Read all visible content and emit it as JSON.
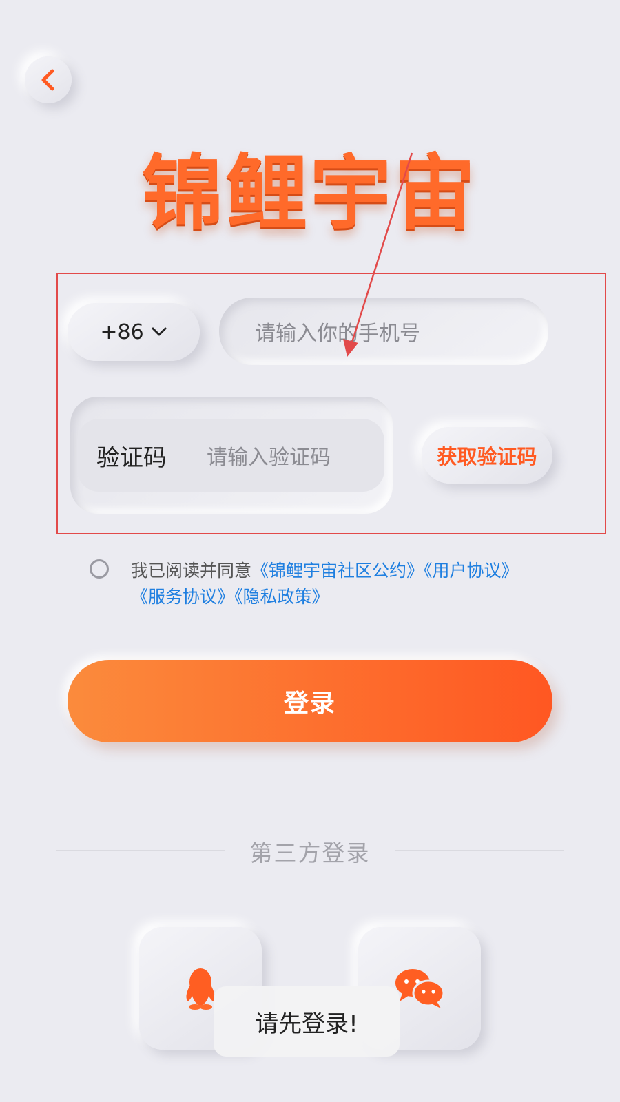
{
  "app": {
    "logo_text": "锦鲤宇宙"
  },
  "phone": {
    "country_code": "+86",
    "placeholder": "请输入你的手机号"
  },
  "verify": {
    "label": "验证码",
    "placeholder": "请输入验证码",
    "get_code": "获取验证码"
  },
  "agreement": {
    "prefix": "我已阅读并同意",
    "links": [
      "《锦鲤宇宙社区公约》",
      "《用户协议》",
      "《服务协议》",
      "《隐私政策》"
    ]
  },
  "login": {
    "label": "登录"
  },
  "third_party": {
    "title": "第三方登录",
    "options": [
      "qq-icon",
      "wechat-icon"
    ]
  },
  "toast": {
    "message": "请先登录!"
  },
  "colors": {
    "accent": "#ff5a22",
    "gradient_start": "#fb8b3c",
    "gradient_end": "#ff5722",
    "link": "#1f7fe0",
    "annotation": "#e24a4a"
  }
}
